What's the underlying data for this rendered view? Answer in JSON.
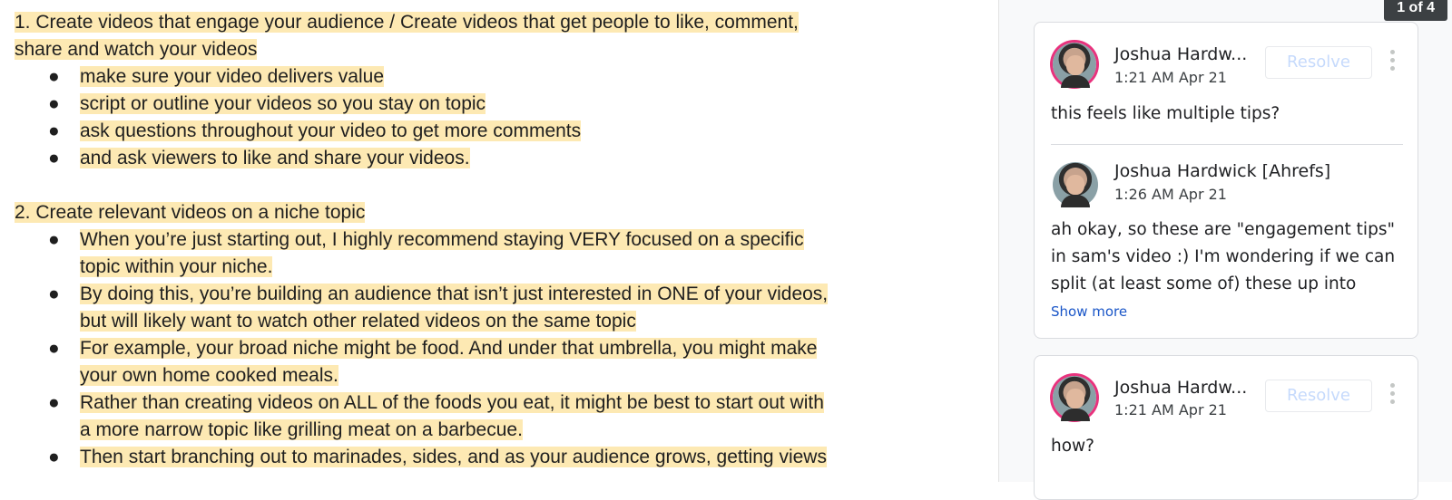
{
  "document": {
    "p1": [
      "1. Create videos that engage your audience / Create videos that get people to like, comment,",
      "share and watch your videos"
    ],
    "p1_bullets": [
      "make sure your video delivers value",
      "script or outline your videos so you stay on topic",
      "ask questions throughout your video to get more comments",
      "and ask viewers to like and share your videos."
    ],
    "p2": "2. Create relevant videos on a niche topic",
    "p2_bullets": [
      [
        "When you’re just starting out, I highly recommend staying VERY focused on a specific",
        "topic within your niche."
      ],
      [
        "By doing this, you’re building an audience that isn’t just interested in ONE of your videos,",
        "but will likely want to watch other related videos on the same topic"
      ],
      [
        "For example, your broad niche might be food. And under that umbrella, you might make",
        "your own home cooked meals."
      ],
      [
        "Rather than creating videos on ALL of the foods you eat, it might be best to start out with",
        "a more narrow topic like grilling meat on a barbecue."
      ],
      [
        "Then start branching out to marinades, sides, and as your audience grows, getting views"
      ]
    ],
    "bullet_glyph": "●"
  },
  "comments": {
    "counter": "1 of 4",
    "resolve_label": "Resolve",
    "show_more_label": "Show more",
    "threads": [
      {
        "author": "Joshua Hardw...",
        "time": "1:21 AM Apr 21",
        "text": "this feels like multiple tips?",
        "reply": {
          "author": "Joshua Hardwick [Ahrefs]",
          "time": "1:26 AM Apr 21",
          "lines": [
            "ah okay, so these are \"engagement tips\"",
            "in sam's video :) I'm wondering if we can",
            "split (at least some of) these up into"
          ]
        }
      },
      {
        "author": "Joshua Hardw...",
        "time": "1:21 AM Apr 21",
        "text": "how?"
      }
    ]
  },
  "colors": {
    "highlight": "#fde9b3",
    "avatar_ring": "#e8327d",
    "link": "#1a56c8"
  }
}
